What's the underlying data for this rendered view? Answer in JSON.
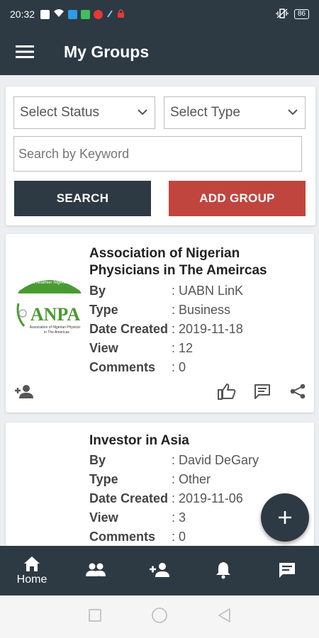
{
  "status_bar": {
    "time": "20:32",
    "battery": "86",
    "icons": [
      "image-icon",
      "wifi-icon",
      "app-icon-blue",
      "app-icon-green",
      "youtube-icon",
      "pen-icon",
      "lock-icon"
    ],
    "right_icons": [
      "vibrate-icon"
    ]
  },
  "app_bar": {
    "title": "My Groups",
    "menu_icon": "hamburger-menu-icon"
  },
  "filters": {
    "status_select": "Select Status",
    "type_select": "Select Type",
    "search_placeholder": "Search by Keyword",
    "search_button": "SEARCH",
    "add_group_button": "ADD GROUP"
  },
  "labels": {
    "by": "By",
    "type": "Type",
    "date_created": "Date Created",
    "view": "View",
    "comments": "Comments"
  },
  "groups": [
    {
      "title": "Association of Nigerian Physicians in The Ameircas",
      "by": ": UABN LinK",
      "type": ": Business",
      "date_created": ": 2019-11-18",
      "view": ": 12",
      "comments": ": 0",
      "logo": {
        "tagline": "a healthier Nigeria",
        "acronym": "ANPA",
        "subtitle_1": "Association of Nigerian Physicians",
        "subtitle_2": "in The Americas"
      }
    },
    {
      "title": "Investor in Asia",
      "by": ": David DeGary",
      "type": ": Other",
      "date_created": ": 2019-11-06",
      "view": ": 3",
      "comments": ": 0"
    }
  ],
  "bottom_nav": [
    {
      "label": "Home",
      "icon": "home-icon"
    },
    {
      "label": "",
      "icon": "groups-icon"
    },
    {
      "label": "",
      "icon": "add-person-icon"
    },
    {
      "label": "",
      "icon": "bell-icon"
    },
    {
      "label": "",
      "icon": "chat-icon"
    }
  ],
  "colors": {
    "primary": "#2d3a44",
    "add_button": "#c0453f",
    "logo_green": "#4a9a32"
  }
}
